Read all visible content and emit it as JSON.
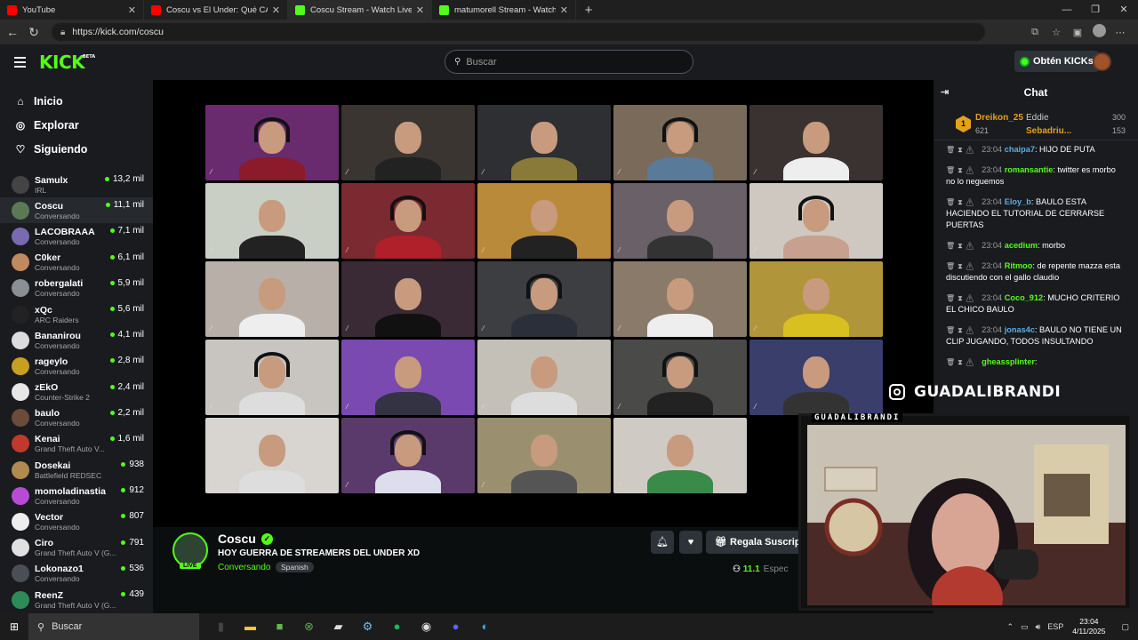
{
  "browser": {
    "tabs": [
      {
        "label": "YouTube",
        "color": "#ff0000"
      },
      {
        "label": "Coscu vs El Under: Qué CARAJOS",
        "color": "#ff0000"
      },
      {
        "label": "Coscu Stream - Watch Live on",
        "color": "#53fc18"
      },
      {
        "label": "matumorell Stream - Watch",
        "color": "#53fc18"
      }
    ],
    "url": "https://kick.com/coscu"
  },
  "header": {
    "logo": "KICK",
    "logo_badge": "BETA",
    "search_placeholder": "Buscar",
    "kicks_button": "Obtén KICKs"
  },
  "sidebar": {
    "nav": [
      {
        "label": "Inicio",
        "icon": "home-icon"
      },
      {
        "label": "Explorar",
        "icon": "compass-icon"
      },
      {
        "label": "Siguiendo",
        "icon": "heart-icon"
      }
    ],
    "channels": [
      {
        "name": "Samulx",
        "category": "IRL",
        "viewers": "13,2 mil",
        "color": "#444"
      },
      {
        "name": "Coscu",
        "category": "Conversando",
        "viewers": "11,1 mil",
        "color": "#5a7a55"
      },
      {
        "name": "LACOBRAAA",
        "category": "Conversando",
        "viewers": "7,1 mil",
        "color": "#7a6ab0"
      },
      {
        "name": "C0ker",
        "category": "Conversando",
        "viewers": "6,1 mil",
        "color": "#c08a60"
      },
      {
        "name": "robergalati",
        "category": "Conversando",
        "viewers": "5,9 mil",
        "color": "#8a8f96"
      },
      {
        "name": "xQc",
        "category": "ARC Raiders",
        "viewers": "5,6 mil",
        "color": "#222"
      },
      {
        "name": "Bananirou",
        "category": "Conversando",
        "viewers": "4,1 mil",
        "color": "#dcdcdc"
      },
      {
        "name": "rageylo",
        "category": "Conversando",
        "viewers": "2,8 mil",
        "color": "#c8a020"
      },
      {
        "name": "zEkO",
        "category": "Counter-Strike 2",
        "viewers": "2,4 mil",
        "color": "#e6e6e6"
      },
      {
        "name": "baulo",
        "category": "Conversando",
        "viewers": "2,2 mil",
        "color": "#6b4b3a"
      },
      {
        "name": "Kenai",
        "category": "Grand Theft Auto V...",
        "viewers": "1,6 mil",
        "color": "#c0392b"
      },
      {
        "name": "Dosekai",
        "category": "Battlefield REDSEC",
        "viewers": "938",
        "color": "#b08a50"
      },
      {
        "name": "momoladinastia",
        "category": "Conversando",
        "viewers": "912",
        "color": "#b84ad6"
      },
      {
        "name": "Vector",
        "category": "Conversando",
        "viewers": "807",
        "color": "#eee"
      },
      {
        "name": "Ciro",
        "category": "Grand Theft Auto V (G...",
        "viewers": "791",
        "color": "#e0e0e0"
      },
      {
        "name": "Lokonazo1",
        "category": "Conversando",
        "viewers": "536",
        "color": "#4a4f55"
      },
      {
        "name": "ReenZ",
        "category": "Grand Theft Auto V (G...",
        "viewers": "439",
        "color": "#2e8b57"
      }
    ]
  },
  "stream": {
    "streamer": "Coscu",
    "live_badge": "LIVE",
    "title": "HOY GUERRA DE STREAMERS DEL UNDER XD",
    "category": "Conversando",
    "language": "Spanish",
    "gift_button": "Regala Suscrip",
    "viewers": "11.1",
    "viewers_suffix": "Espec",
    "overlay_name": "GUADALIBRANDI",
    "overlay_tag": "GUADALIBRANDI"
  },
  "chat": {
    "title": "Chat",
    "leaderboard": [
      {
        "name": "Dreikon_25",
        "value": "621"
      },
      {
        "name": "Eddie",
        "value": "300"
      },
      {
        "name": "Sebadriu...",
        "value": "153"
      }
    ],
    "leader_rank": "1",
    "messages": [
      {
        "time": "23:04",
        "user": "chaipa7",
        "color": "#5dade2",
        "text": ": HIJO DE PUTA"
      },
      {
        "time": "23:04",
        "user": "romansantie",
        "color": "#53fc18",
        "text": ": twitter es morbo no lo neguemos"
      },
      {
        "time": "23:04",
        "user": "Eloy_b",
        "color": "#5dade2",
        "text": ": BAULO ESTA HACIENDO EL TUTORIAL DE CERRARSE PUERTAS"
      },
      {
        "time": "23:04",
        "user": "acedium",
        "color": "#53fc18",
        "text": ": morbo"
      },
      {
        "time": "23:04",
        "user": "Ritmoo",
        "color": "#53fc18",
        "text": ": de repente mazza esta discutiendo con el gallo claudio"
      },
      {
        "time": "23:04",
        "user": "Coco_912",
        "color": "#53fc18",
        "text": ": MUCHO CRITERIO EL CHICO BAULO"
      },
      {
        "time": "23:04",
        "user": "jonas4c",
        "color": "#5dade2",
        "text": ": BAULO NO TIENE UN CLIP JUGANDO, TODOS INSULTANDO"
      },
      {
        "time": "",
        "user": "gheassplinter",
        "color": "#53fc18",
        "text": ":"
      }
    ]
  },
  "taskbar": {
    "search_placeholder": "Buscar",
    "lang": "ESP",
    "time": "23:04",
    "date": "4/11/2025"
  }
}
